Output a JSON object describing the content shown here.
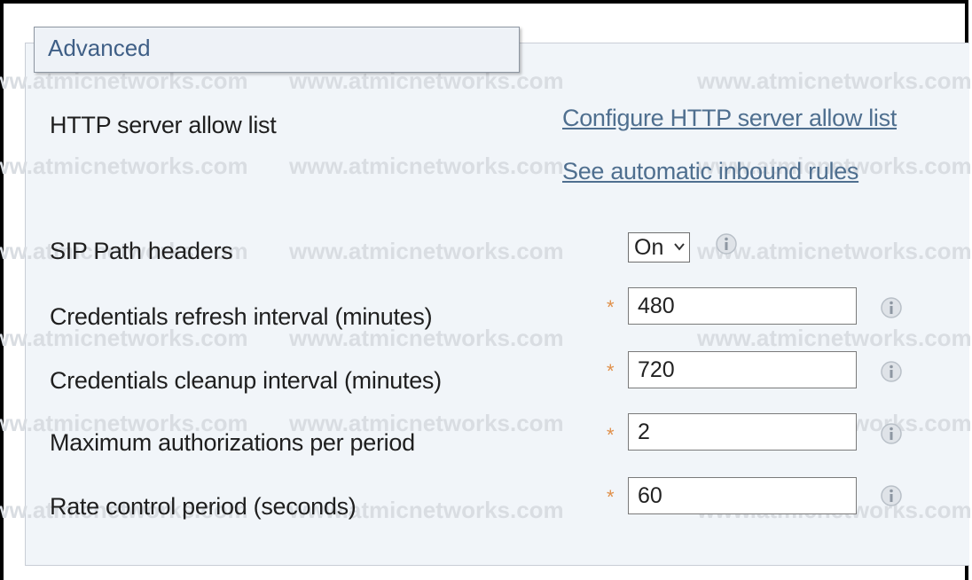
{
  "section": {
    "title": "Advanced"
  },
  "watermark": "www.atmicnetworks.com",
  "rows": {
    "http_allow_list": {
      "label": "HTTP server allow list",
      "link_configure": "Configure HTTP server allow list",
      "link_inbound": "See automatic inbound rules"
    },
    "sip_path": {
      "label": "SIP Path headers",
      "value": "On"
    },
    "cred_refresh": {
      "label": "Credentials refresh interval (minutes)",
      "value": "480"
    },
    "cred_cleanup": {
      "label": "Credentials cleanup interval (minutes)",
      "value": "720"
    },
    "max_auth": {
      "label": "Maximum authorizations per period",
      "value": "2"
    },
    "rate_period": {
      "label": "Rate control period (seconds)",
      "value": "60"
    }
  },
  "required_marker": "*",
  "colors": {
    "link": "#4f6f8f",
    "required": "#e0904a",
    "panel_bg": "#f1f5f9"
  }
}
